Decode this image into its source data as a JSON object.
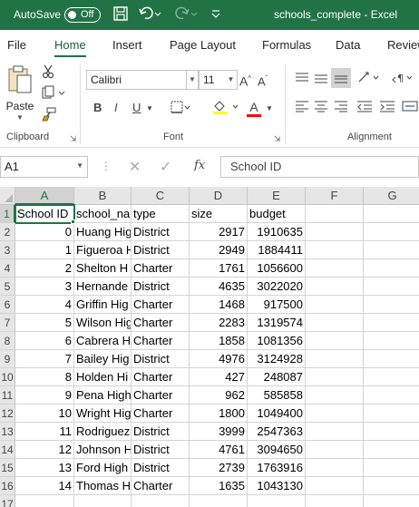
{
  "titlebar": {
    "autosave_label": "AutoSave",
    "toggle_label": "Off",
    "title": "schools_complete  -  Excel"
  },
  "menu": {
    "tabs": [
      "File",
      "Home",
      "Insert",
      "Page Layout",
      "Formulas",
      "Data",
      "Review"
    ],
    "active": "Home"
  },
  "ribbon": {
    "clipboard": {
      "paste_label": "Paste",
      "group_label": "Clipboard"
    },
    "font": {
      "font_name": "Calibri",
      "font_size": "11",
      "group_label": "Font",
      "bold": "B",
      "italic": "I",
      "underline": "U",
      "font_color_letter": "A",
      "font_color": "#ff0000"
    },
    "alignment": {
      "group_label": "Alignment"
    }
  },
  "formula_bar": {
    "name_box": "A1",
    "fx": "fx",
    "content": "School ID"
  },
  "grid": {
    "columns": [
      "A",
      "B",
      "C",
      "D",
      "E",
      "F",
      "G"
    ],
    "active_cell": "A1",
    "rows": [
      {
        "num": "1",
        "cells": [
          "School ID",
          "school_na",
          "type",
          "size",
          "budget"
        ]
      },
      {
        "num": "2",
        "cells": [
          "0",
          "Huang Hig",
          "District",
          "2917",
          "1910635"
        ]
      },
      {
        "num": "3",
        "cells": [
          "1",
          "Figueroa H",
          "District",
          "2949",
          "1884411"
        ]
      },
      {
        "num": "4",
        "cells": [
          "2",
          "Shelton H",
          "Charter",
          "1761",
          "1056600"
        ]
      },
      {
        "num": "5",
        "cells": [
          "3",
          "Hernande",
          "District",
          "4635",
          "3022020"
        ]
      },
      {
        "num": "6",
        "cells": [
          "4",
          "Griffin Hig",
          "Charter",
          "1468",
          "917500"
        ]
      },
      {
        "num": "7",
        "cells": [
          "5",
          "Wilson Hig",
          "Charter",
          "2283",
          "1319574"
        ]
      },
      {
        "num": "8",
        "cells": [
          "6",
          "Cabrera H",
          "Charter",
          "1858",
          "1081356"
        ]
      },
      {
        "num": "9",
        "cells": [
          "7",
          "Bailey Hig",
          "District",
          "4976",
          "3124928"
        ]
      },
      {
        "num": "10",
        "cells": [
          "8",
          "Holden Hi",
          "Charter",
          "427",
          "248087"
        ]
      },
      {
        "num": "11",
        "cells": [
          "9",
          "Pena High",
          "Charter",
          "962",
          "585858"
        ]
      },
      {
        "num": "12",
        "cells": [
          "10",
          "Wright Hig",
          "Charter",
          "1800",
          "1049400"
        ]
      },
      {
        "num": "13",
        "cells": [
          "11",
          "Rodriguez",
          "District",
          "3999",
          "2547363"
        ]
      },
      {
        "num": "14",
        "cells": [
          "12",
          "Johnson H",
          "District",
          "4761",
          "3094650"
        ]
      },
      {
        "num": "15",
        "cells": [
          "13",
          "Ford High",
          "District",
          "2739",
          "1763916"
        ]
      },
      {
        "num": "16",
        "cells": [
          "14",
          "Thomas H",
          "Charter",
          "1635",
          "1043130"
        ]
      },
      {
        "num": "17",
        "cells": [
          "",
          "",
          "",
          "",
          ""
        ]
      }
    ]
  }
}
